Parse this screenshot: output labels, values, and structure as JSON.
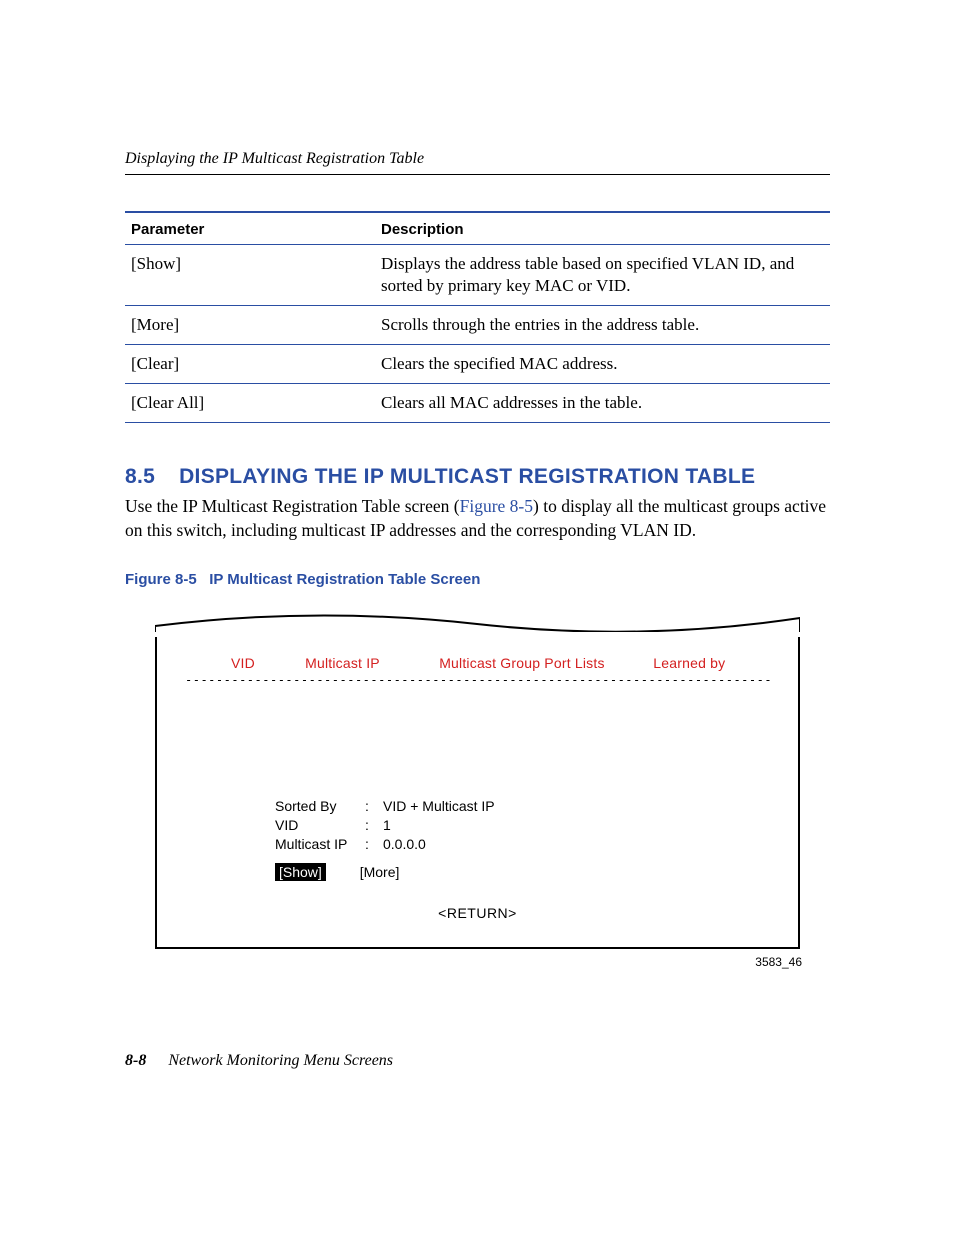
{
  "running_head": "Displaying the IP Multicast Registration Table",
  "table": {
    "headers": {
      "param": "Parameter",
      "desc": "Description"
    },
    "rows": [
      {
        "param": "[Show]",
        "desc": "Displays the address table based on specified VLAN ID, and sorted by primary key MAC or VID."
      },
      {
        "param": "[More]",
        "desc": "Scrolls through the entries in the address table."
      },
      {
        "param": "[Clear]",
        "desc": "Clears the specified MAC address."
      },
      {
        "param": "[Clear All]",
        "desc": "Clears all MAC addresses in the table."
      }
    ]
  },
  "section": {
    "number": "8.5",
    "title": "DISPLAYING THE IP MULTICAST REGISTRATION TABLE",
    "body_pre": "Use the IP Multicast Registration Table screen (",
    "body_link": "Figure 8-5",
    "body_post": ") to display all the multicast groups active on this switch, including multicast IP addresses and the corresponding VLAN ID."
  },
  "figure": {
    "caption_label": "Figure 8-5",
    "caption_title": "IP Multicast Registration Table Screen",
    "headers": {
      "vid": "VID",
      "mip": "Multicast IP",
      "grp": "Multicast Group Port Lists",
      "learned": "Learned by"
    },
    "fields": {
      "sorted_by_label": "Sorted By",
      "sorted_by_value": "VID + Multicast IP",
      "vid_label": "VID",
      "vid_value": "1",
      "mip_label": "Multicast IP",
      "mip_value": "0.0.0.0"
    },
    "buttons": {
      "show": "[Show]",
      "more": "[More]"
    },
    "return": "<RETURN>",
    "id": "3583_46"
  },
  "footer": {
    "page": "8-8",
    "title": "Network Monitoring Menu Screens"
  }
}
